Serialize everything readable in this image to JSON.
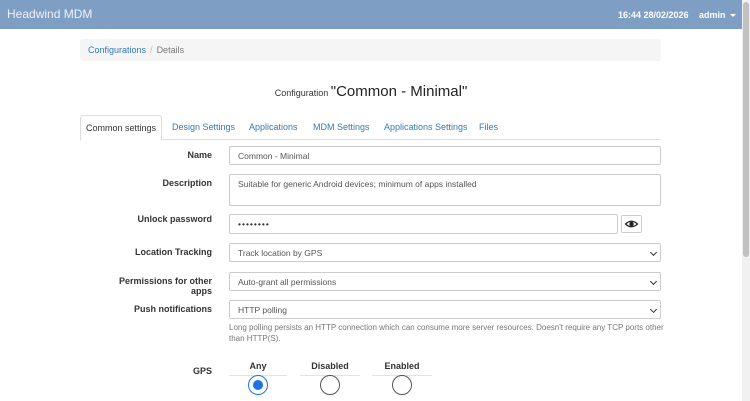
{
  "app": {
    "brand": "Headwind MDM",
    "datetime": "16:44 28/02/2026",
    "user": "admin"
  },
  "breadcrumb": {
    "root": "Configurations",
    "separator": "/",
    "current": "Details"
  },
  "page": {
    "title_prefix": "Configuration",
    "title_name": "\"Common - Minimal\""
  },
  "tabs": [
    {
      "label": "Common settings",
      "active": true
    },
    {
      "label": "Design Settings"
    },
    {
      "label": "Applications"
    },
    {
      "label": "MDM Settings"
    },
    {
      "label": "Applications Settings"
    },
    {
      "label": "Files"
    }
  ],
  "form": {
    "name": {
      "label": "Name",
      "value": "Common - Minimal"
    },
    "description": {
      "label": "Description",
      "value": "Suitable for generic Android devices; minimum of apps installed"
    },
    "unlock_password": {
      "label": "Unlock password",
      "value": "••••••••"
    },
    "location_tracking": {
      "label": "Location Tracking",
      "value": "Track location by GPS"
    },
    "permissions": {
      "label": "Permissions for other apps",
      "value": "Auto-grant all permissions"
    },
    "push": {
      "label": "Push notifications",
      "value": "HTTP polling",
      "help": "Long polling persists an HTTP connection which can consume more server resources. Doesn't require any TCP ports other than HTTP(S)."
    },
    "gps": {
      "label": "GPS",
      "options": [
        {
          "label": "Any",
          "checked": true
        },
        {
          "label": "Disabled",
          "checked": false
        },
        {
          "label": "Enabled",
          "checked": false
        }
      ]
    }
  },
  "icons": {
    "eye": "eye-icon",
    "caret": "caret-down-icon"
  },
  "colors": {
    "navbar": "#7f9ec4",
    "link": "#337ab7",
    "radio_checked": "#1a73e8"
  }
}
